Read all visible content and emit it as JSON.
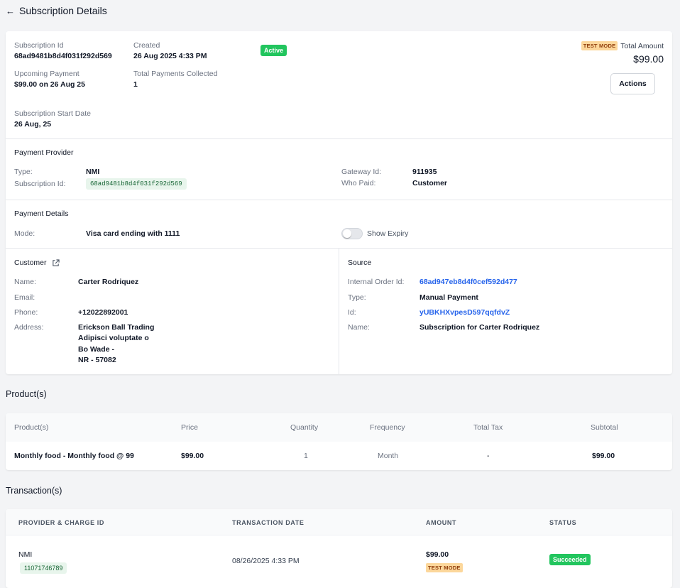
{
  "header": {
    "back_arrow": "←",
    "title": "Subscription Details"
  },
  "summary": {
    "subscription_id_label": "Subscription Id",
    "subscription_id": "68ad9481b8d4f031f292d569",
    "created_label": "Created",
    "created": "26 Aug 2025 4:33 PM",
    "status": "Active",
    "upcoming_payment_label": "Upcoming Payment",
    "upcoming_payment": "$99.00 on 26 Aug 25",
    "total_payments_label": "Total Payments Collected",
    "total_payments": "1",
    "start_date_label": "Subscription Start Date",
    "start_date": "26 Aug, 25",
    "test_mode": "TEST MODE",
    "total_amount_label": "Total Amount",
    "total_amount": "$99.00",
    "actions_label": "Actions"
  },
  "payment_provider": {
    "title": "Payment Provider",
    "type_label": "Type:",
    "type": "NMI",
    "subscription_id_label": "Subscription Id:",
    "subscription_id": "68ad9481b8d4f031f292d569",
    "gateway_id_label": "Gateway Id:",
    "gateway_id": "911935",
    "who_paid_label": "Who Paid:",
    "who_paid": "Customer"
  },
  "payment_details": {
    "title": "Payment Details",
    "mode_label": "Mode:",
    "mode": "Visa card ending with 1111",
    "show_expiry_label": "Show Expiry",
    "show_expiry": false
  },
  "customer": {
    "title": "Customer",
    "name_label": "Name:",
    "name": "Carter Rodriquez",
    "email_label": "Email:",
    "email": "",
    "phone_label": "Phone:",
    "phone": "+12022892001",
    "address_label": "Address:",
    "address": [
      "Erickson Ball Trading",
      "Adipisci voluptate o",
      "Bo Wade -",
      "NR - 57082"
    ]
  },
  "source": {
    "title": "Source",
    "internal_order_label": "Internal Order Id:",
    "internal_order": "68ad947eb8d4f0cef592d477",
    "type_label": "Type:",
    "type": "Manual Payment",
    "id_label": "Id:",
    "id": "yUBKHXvpesD597qqfdvZ",
    "name_label": "Name:",
    "name": "Subscription for Carter Rodriquez"
  },
  "products": {
    "section_title": "Product(s)",
    "headers": [
      "Product(s)",
      "Price",
      "Quantity",
      "Frequency",
      "Total Tax",
      "Subtotal"
    ],
    "rows": [
      [
        "Monthly food - Monthly food @ 99",
        "$99.00",
        "1",
        "Month",
        "-",
        "$99.00"
      ]
    ]
  },
  "transactions": {
    "section_title": "Transaction(s)",
    "headers": [
      "PROVIDER & CHARGE ID",
      "TRANSACTION DATE",
      "AMOUNT",
      "STATUS"
    ],
    "rows": [
      {
        "provider": "NMI",
        "charge_id": "11071746789",
        "date": "08/26/2025 4:33 PM",
        "amount": "$99.00",
        "mode": "TEST MODE",
        "status": "Succeeded"
      }
    ]
  },
  "colors": {
    "success": "#22c55e",
    "link": "#2563eb",
    "test_badge": "#fcd79b"
  }
}
